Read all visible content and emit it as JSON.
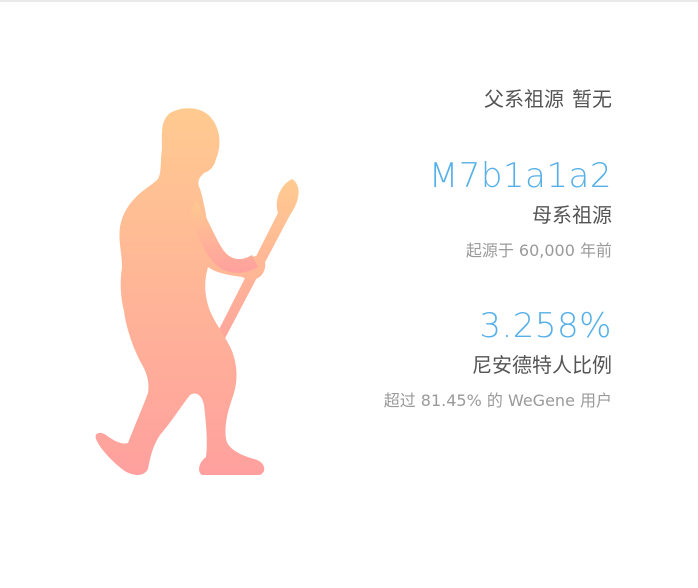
{
  "paternal": {
    "label": "父系祖源",
    "value": "暂无"
  },
  "maternal": {
    "haplogroup": "M7b1a1a2",
    "label": "母系祖源",
    "origin": "起源于 60,000 年前"
  },
  "neanderthal": {
    "percent": "3.258%",
    "label": "尼安德特人比例",
    "comparison": "超过 81.45% 的 WeGene 用户"
  },
  "icons": {
    "figure": "neanderthal-figure-icon"
  },
  "colors": {
    "accent": "#56b0e8",
    "figure_top": "#ffc891",
    "figure_bottom": "#ff9f9f",
    "text_primary": "#555555",
    "text_secondary": "#9a9a9a"
  }
}
